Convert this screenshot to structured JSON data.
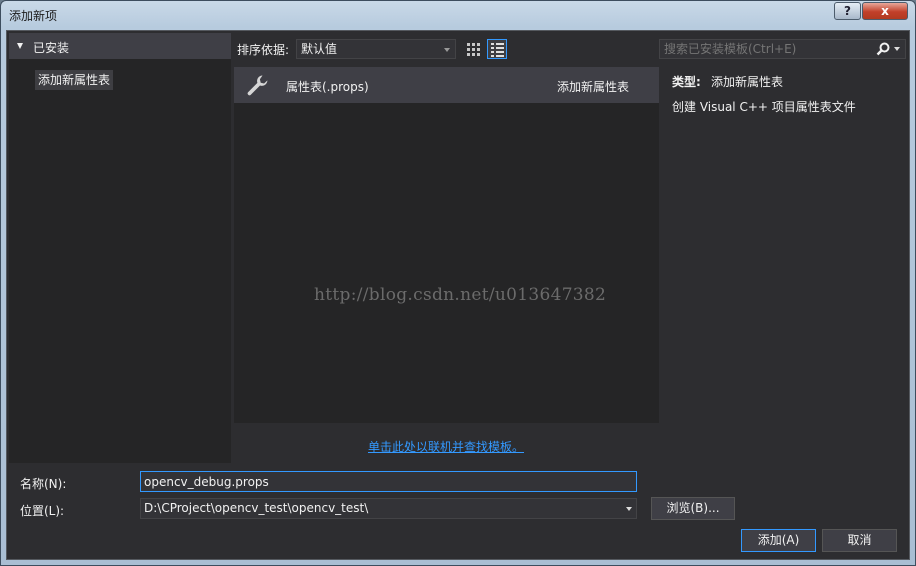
{
  "window": {
    "title": "添加新项",
    "help_label": "?",
    "close_label": "x"
  },
  "left_panel": {
    "header": "已安装",
    "items": [
      "添加新属性表"
    ]
  },
  "sort": {
    "label": "排序依据:",
    "value": "默认值"
  },
  "search": {
    "placeholder": "搜索已安装模板(Ctrl+E)"
  },
  "templates": [
    {
      "name": "属性表(.props)",
      "category": "添加新属性表",
      "icon": "wrench-icon"
    }
  ],
  "watermark": "http://blog.csdn.net/u013647382",
  "online_link": "单击此处以联机并查找模板。",
  "details": {
    "type_label": "类型:",
    "type_value": "添加新属性表",
    "description": "创建 Visual C++ 项目属性表文件"
  },
  "form": {
    "name_label": "名称(N):",
    "name_value": "opencv_debug.props",
    "location_label": "位置(L):",
    "location_value": "D:\\CProject\\opencv_test\\opencv_test\\",
    "browse_label": "浏览(B)...",
    "add_label": "添加(A)",
    "cancel_label": "取消"
  },
  "colors": {
    "accent": "#3399ff",
    "background": "#2d2d30",
    "panel": "#252526",
    "selected": "#3f3f46"
  }
}
